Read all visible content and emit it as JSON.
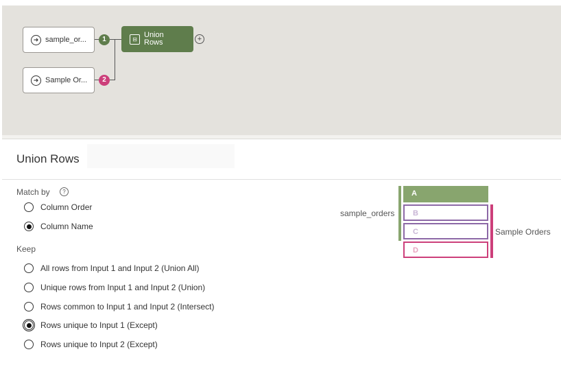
{
  "flow": {
    "input1_label": "sample_or...",
    "input2_label": "Sample Or...",
    "input1_badge": "1",
    "input2_badge": "2",
    "union_label_line1": "Union",
    "union_label_line2": "Rows",
    "colors": {
      "union_node": "#5f7d4c",
      "badge1": "#5f7d4c",
      "badge2": "#cc3f7a"
    }
  },
  "panel": {
    "title": "Union Rows",
    "match_by_label": "Match by",
    "match_by_options": [
      {
        "label": "Column Order",
        "selected": false
      },
      {
        "label": "Column Name",
        "selected": true
      }
    ],
    "keep_label": "Keep",
    "keep_options": [
      {
        "label": "All rows from Input 1 and Input 2 (Union All)",
        "selected": false
      },
      {
        "label": "Unique rows from Input 1 and Input 2 (Union)",
        "selected": false
      },
      {
        "label": "Rows common to Input 1 and Input 2 (Intersect)",
        "selected": false
      },
      {
        "label": "Rows unique to Input 1 (Except)",
        "selected": true
      },
      {
        "label": "Rows unique to Input 2 (Except)",
        "selected": false
      }
    ]
  },
  "diagram": {
    "input1_name": "sample_orders",
    "input2_name": "Sample Orders",
    "blocks": [
      "A",
      "B",
      "C",
      "D"
    ],
    "colors": {
      "green": "#88a56e",
      "purple": "#8c68a6",
      "pink": "#cc3f7a"
    }
  },
  "icons": [
    "arrow-circle-icon",
    "union-icon",
    "add-circle-icon",
    "help-icon"
  ]
}
